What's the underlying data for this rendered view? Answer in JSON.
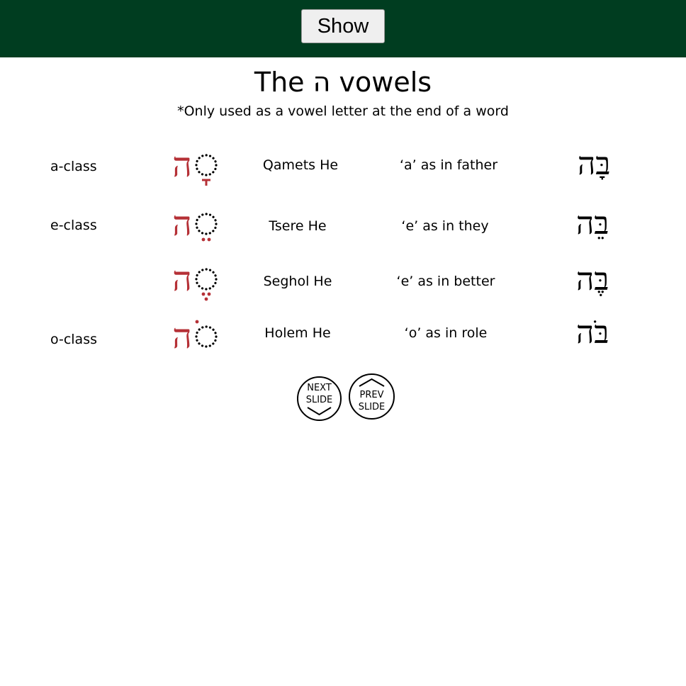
{
  "toolbar": {
    "show_label": "Show"
  },
  "title": "The ה vowels",
  "subtitle": "*Only used as a vowel letter at the end of a word",
  "rows": [
    {
      "class_label": "a-class",
      "name": "Qamets He",
      "sound": "‘a’ as in father",
      "example": "בָּה"
    },
    {
      "class_label": "e-class",
      "name": "Tsere He",
      "sound": "‘e’ as in they",
      "example": "בֵּה"
    },
    {
      "class_label": "",
      "name": "Seghol He",
      "sound": "‘e’ as in better",
      "example": "בֶּה"
    },
    {
      "class_label": "o-class",
      "name": "Holem He",
      "sound": "‘o’ as in role",
      "example": "בֹּה"
    }
  ],
  "symbol_letter": "ה",
  "nav": {
    "next_line1": "NEXT",
    "next_line2": "SLIDE",
    "prev_line1": "PREV",
    "prev_line2": "SLIDE"
  },
  "colors": {
    "header": "#003d20",
    "accent": "#b53036"
  },
  "icons": {
    "next": "chevron-down-icon",
    "prev": "chevron-up-icon"
  }
}
